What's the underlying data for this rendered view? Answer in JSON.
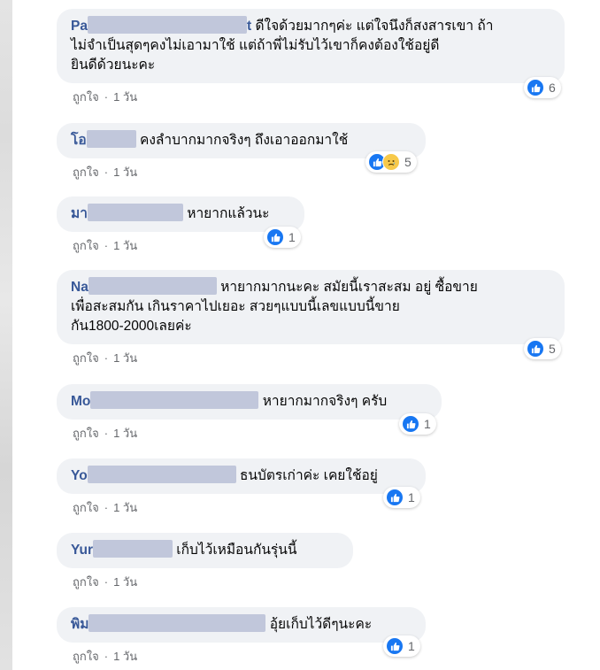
{
  "meta": {
    "like_label": "ถูกใจ",
    "separator": "·",
    "time_label": "1 วัน"
  },
  "comments": [
    {
      "name_prefix": "Pa",
      "name_suffix": "t",
      "lines": [
        "ดีใจด้วยมากๆค่ะ แต่ใจนึงก็สงสารเขา ถ้า",
        "ไม่จำเป็นสุดๆคงไม่เอามาใช้ แต่ถ้าพี่ไม่รับไว้เขาก็คงต้องใช้อยู่ดี",
        "ยินดีด้วยนะคะ"
      ],
      "reactions": [
        "like"
      ],
      "reaction_count": "6"
    },
    {
      "name_prefix": "โอ",
      "name_suffix": "",
      "lines": [
        "คงลำบากมากจริงๆ ถึงเอาออกมาใช้"
      ],
      "reactions": [
        "like",
        "sad"
      ],
      "reaction_count": "5"
    },
    {
      "name_prefix": "มา",
      "name_suffix": "",
      "lines": [
        "หายากแล้วนะ"
      ],
      "reactions": [
        "like"
      ],
      "reaction_count": "1"
    },
    {
      "name_prefix": "Na",
      "name_suffix": "",
      "lines": [
        "หายากมากนะคะ สมัยนี้เราสะสม อยู่ ซื้อขาย",
        "เพื่อสะสมกัน เกินราคาไปเยอะ สวยๆแบบนี้เลขแบบนี้ขาย",
        "กัน1800-2000เลยค่ะ"
      ],
      "reactions": [
        "like"
      ],
      "reaction_count": "5"
    },
    {
      "name_prefix": "Mo",
      "name_suffix": "",
      "lines": [
        "หายากมากจริงๆ ครับ"
      ],
      "reactions": [
        "like"
      ],
      "reaction_count": "1"
    },
    {
      "name_prefix": "Yo",
      "name_suffix": "",
      "lines": [
        "ธนบัตรเก่าค่ะ เคยใช้อยู่"
      ],
      "reactions": [
        "like"
      ],
      "reaction_count": "1"
    },
    {
      "name_prefix": "Yur",
      "name_suffix": "",
      "lines": [
        "เก็บไว้เหมือนกันรุ่นนี้"
      ],
      "reactions": [],
      "reaction_count": ""
    },
    {
      "name_prefix": "พิม",
      "name_suffix": "",
      "lines": [
        "อุ้ยเก็บไว้ดีๆนะคะ"
      ],
      "reactions": [
        "like"
      ],
      "reaction_count": "1"
    }
  ],
  "icons": {
    "like": "like-icon",
    "sad": "sad-icon"
  },
  "colors": {
    "name": "#385898",
    "bubble": "#f0f2f5",
    "like": "#1877f2",
    "meta": "#65676b"
  }
}
